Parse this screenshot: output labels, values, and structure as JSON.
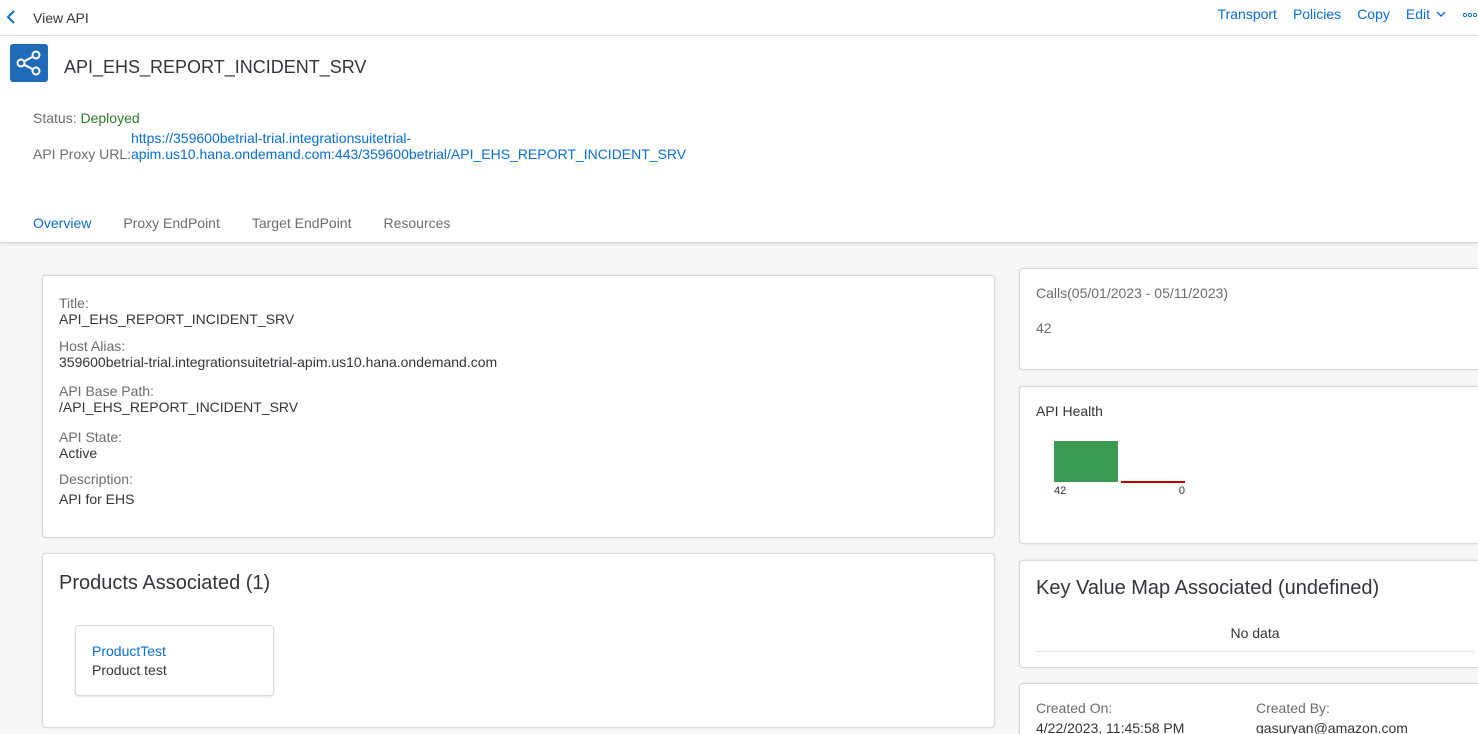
{
  "topbar": {
    "title": "View API",
    "actions": {
      "transport": "Transport",
      "policies": "Policies",
      "copy": "Copy",
      "edit": "Edit"
    }
  },
  "header": {
    "api_name": "API_EHS_REPORT_INCIDENT_SRV",
    "status_label": "Status:",
    "status_value": "Deployed",
    "proxy_label": "API Proxy URL:",
    "proxy_url_line1": "https://359600betrial-trial.integrationsuitetrial-",
    "proxy_url_line2": "apim.us10.hana.ondemand.com:443/359600betrial/API_EHS_REPORT_INCIDENT_SRV"
  },
  "tabs": [
    "Overview",
    "Proxy EndPoint",
    "Target EndPoint",
    "Resources"
  ],
  "details": {
    "title_label": "Title:",
    "title_value": "API_EHS_REPORT_INCIDENT_SRV",
    "host_label": "Host Alias:",
    "host_value": "359600betrial-trial.integrationsuitetrial-apim.us10.hana.ondemand.com",
    "base_path_label": "API Base Path:",
    "base_path_value": "/API_EHS_REPORT_INCIDENT_SRV",
    "state_label": "API State:",
    "state_value": "Active",
    "description_label": "Description:",
    "description_value": "API for EHS"
  },
  "products": {
    "title": "Products Associated (1)",
    "items": [
      {
        "name": "ProductTest",
        "description": "Product test"
      }
    ]
  },
  "calls": {
    "title": "Calls(05/01/2023 - 05/11/2023)",
    "value": "42"
  },
  "health": {
    "title": "API Health",
    "success_color": "#3b9a52",
    "error_color": "#bb0000"
  },
  "chart_data": {
    "type": "bar",
    "categories": [
      "",
      ""
    ],
    "values": [
      42,
      0
    ],
    "data_labels": [
      "42",
      "0"
    ],
    "colors": [
      "#3b9a52",
      "#bb0000"
    ]
  },
  "kvm": {
    "title": "Key Value Map Associated (undefined)",
    "no_data": "No data"
  },
  "created": {
    "on_label": "Created On:",
    "on_value": "4/22/2023, 11:45:58 PM",
    "by_label": "Created By:",
    "by_value": "gasuryan@amazon.com"
  },
  "colors": {
    "accent": "#0a6ed1",
    "status_deployed": "#2b7c2b",
    "api_icon_bg": "#1f6bb7"
  },
  "icons": [
    "chevron-left-icon",
    "network-share-icon",
    "chevron-down-icon",
    "overflow-icon"
  ]
}
